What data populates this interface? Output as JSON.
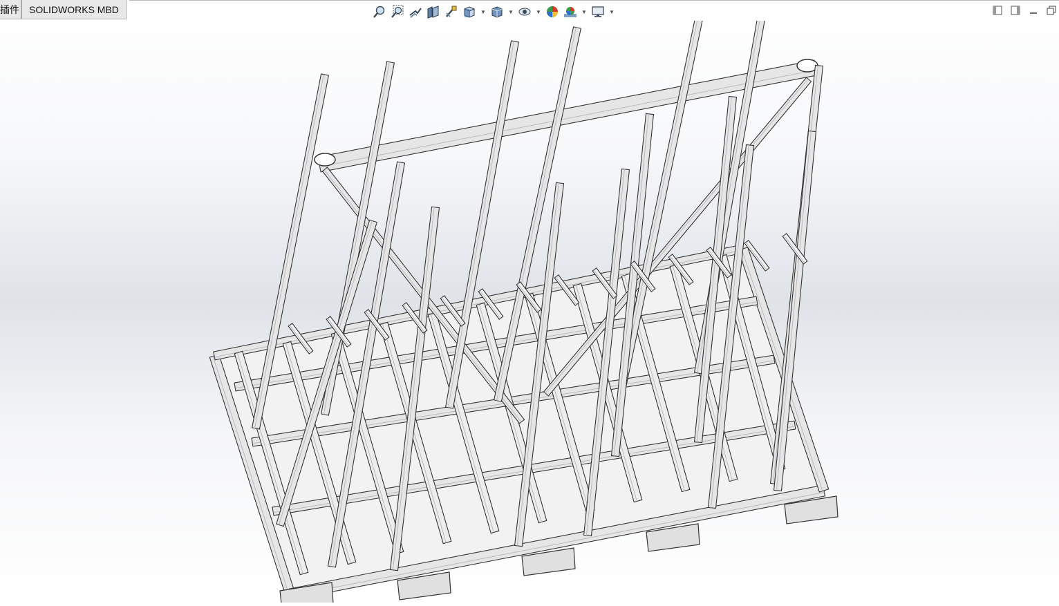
{
  "tabs": [
    {
      "label": "插件"
    },
    {
      "label": "SOLIDWORKS MBD"
    }
  ],
  "toolbar": {
    "icons": [
      "zoom-to-fit-icon",
      "zoom-to-area-icon",
      "previous-view-icon",
      "section-view-icon",
      "dynamic-annotation-icon",
      "view-orientation-icon",
      "display-style-icon",
      "hide-show-items-icon",
      "edit-appearance-icon",
      "apply-scene-icon",
      "view-settings-icon"
    ]
  },
  "window_controls": [
    "tile-left-icon",
    "tile-right-icon",
    "minimize-icon",
    "restore-icon"
  ],
  "model": {
    "name": "glass-rack-assembly",
    "colors": {
      "edge": "#333333",
      "face": "#e6e6e6",
      "shade": "#b9b9c2",
      "light": "#ffffff"
    }
  }
}
